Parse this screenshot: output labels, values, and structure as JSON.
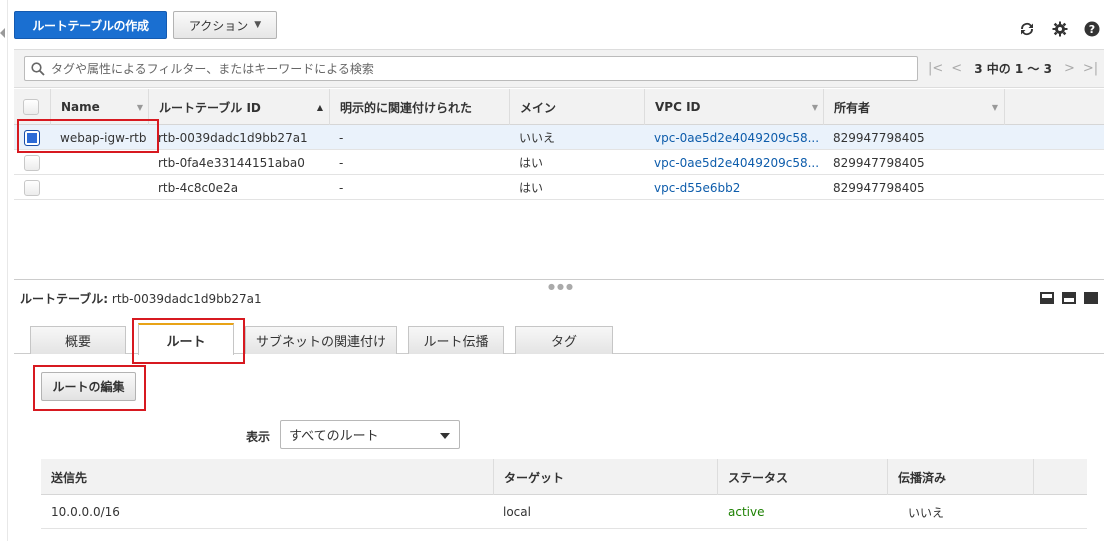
{
  "toolbar": {
    "create_label": "ルートテーブルの作成",
    "action_label": "アクション"
  },
  "search": {
    "placeholder": "タグや属性によるフィルター、またはキーワードによる検索"
  },
  "pager": {
    "text": "3 中の 1 〜 3"
  },
  "table": {
    "headers": {
      "name": "Name",
      "id": "ルートテーブル ID",
      "explicit": "明示的に関連付けられた",
      "main": "メイン",
      "vpc": "VPC ID",
      "owner": "所有者"
    },
    "rows": [
      {
        "name": "webap-igw-rtb",
        "id": "rtb-0039dadc1d9bb27a1",
        "explicit": "-",
        "main": "いいえ",
        "vpc": "vpc-0ae5d2e4049209c58...",
        "owner": "829947798405",
        "selected": true
      },
      {
        "name": "",
        "id": "rtb-0fa4e33144151aba0",
        "explicit": "-",
        "main": "はい",
        "vpc": "vpc-0ae5d2e4049209c58...",
        "owner": "829947798405",
        "selected": false
      },
      {
        "name": "",
        "id": "rtb-4c8c0e2a",
        "explicit": "-",
        "main": "はい",
        "vpc": "vpc-d55e6bb2",
        "owner": "829947798405",
        "selected": false
      }
    ]
  },
  "detail": {
    "title_label": "ルートテーブル:",
    "title_value": "rtb-0039dadc1d9bb27a1",
    "tabs": [
      "概要",
      "ルート",
      "サブネットの関連付け",
      "ルート伝播",
      "タグ"
    ],
    "active_tab": "ルート",
    "edit_label": "ルートの編集",
    "filter_label": "表示",
    "filter_value": "すべてのルート"
  },
  "routes": {
    "headers": {
      "dest": "送信先",
      "target": "ターゲット",
      "status": "ステータス",
      "propagated": "伝播済み"
    },
    "rows": [
      {
        "dest": "10.0.0.0/16",
        "target": "local",
        "status": "active",
        "propagated": "いいえ"
      }
    ]
  },
  "colors": {
    "primary": "#1a6fd1",
    "link": "#0d5cab",
    "active_status": "#1d8102",
    "highlight_box": "#d71920",
    "active_tab_accent": "#e8a317"
  }
}
